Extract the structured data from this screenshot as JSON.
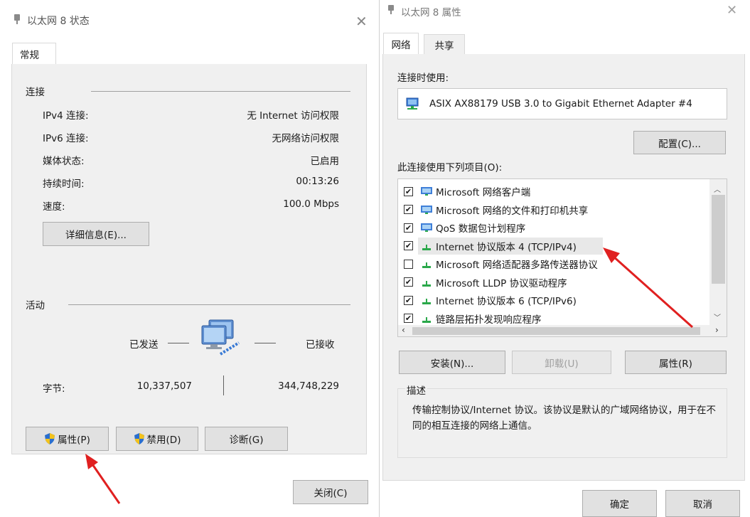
{
  "left": {
    "title": "以太网 8 状态",
    "tab": "常规",
    "connection": {
      "heading": "连接",
      "rows": [
        {
          "label": "IPv4 连接:",
          "value": "无 Internet 访问权限"
        },
        {
          "label": "IPv6 连接:",
          "value": "无网络访问权限"
        },
        {
          "label": "媒体状态:",
          "value": "已启用"
        },
        {
          "label": "持续时间:",
          "value": "00:13:26"
        },
        {
          "label": "速度:",
          "value": "100.0 Mbps"
        }
      ],
      "details_button": "详细信息(E)..."
    },
    "activity": {
      "heading": "活动",
      "sent_label": "已发送",
      "received_label": "已接收",
      "bytes_label": "字节:",
      "sent_value": "10,337,507",
      "received_value": "344,748,229"
    },
    "buttons": {
      "properties": "属性(P)",
      "disable": "禁用(D)",
      "diagnose": "诊断(G)",
      "close": "关闭(C)"
    }
  },
  "right": {
    "title": "以太网 8 属性",
    "tabs": [
      "网络",
      "共享"
    ],
    "connect_using_label": "连接时使用:",
    "adapter_name": "ASIX AX88179 USB 3.0 to Gigabit Ethernet Adapter #4",
    "configure_button": "配置(C)...",
    "items_label": "此连接使用下列项目(O):",
    "items": [
      {
        "label": "Microsoft 网络客户端",
        "checked": true
      },
      {
        "label": "Microsoft 网络的文件和打印机共享",
        "checked": true
      },
      {
        "label": "QoS 数据包计划程序",
        "checked": true
      },
      {
        "label": "Internet 协议版本 4 (TCP/IPv4)",
        "checked": true
      },
      {
        "label": "Microsoft 网络适配器多路传送器协议",
        "checked": false
      },
      {
        "label": "Microsoft LLDP 协议驱动程序",
        "checked": true
      },
      {
        "label": "Internet 协议版本 6 (TCP/IPv6)",
        "checked": true
      },
      {
        "label": "链路层拓扑发现响应程序",
        "checked": true
      }
    ],
    "buttons": {
      "install": "安装(N)...",
      "uninstall": "卸载(U)",
      "properties": "属性(R)",
      "ok": "确定",
      "cancel": "取消"
    },
    "description": {
      "heading": "描述",
      "text": "传输控制协议/Internet 协议。该协议是默认的广域网络协议，用于在不同的相互连接的网络上通信。"
    }
  },
  "colors": {
    "dialog_bg": "#f0f0f0",
    "button_bg": "#e1e1e1",
    "arrow": "#e02020",
    "shield_blue": "#2a6fcf",
    "shield_yellow": "#f3c21b"
  }
}
